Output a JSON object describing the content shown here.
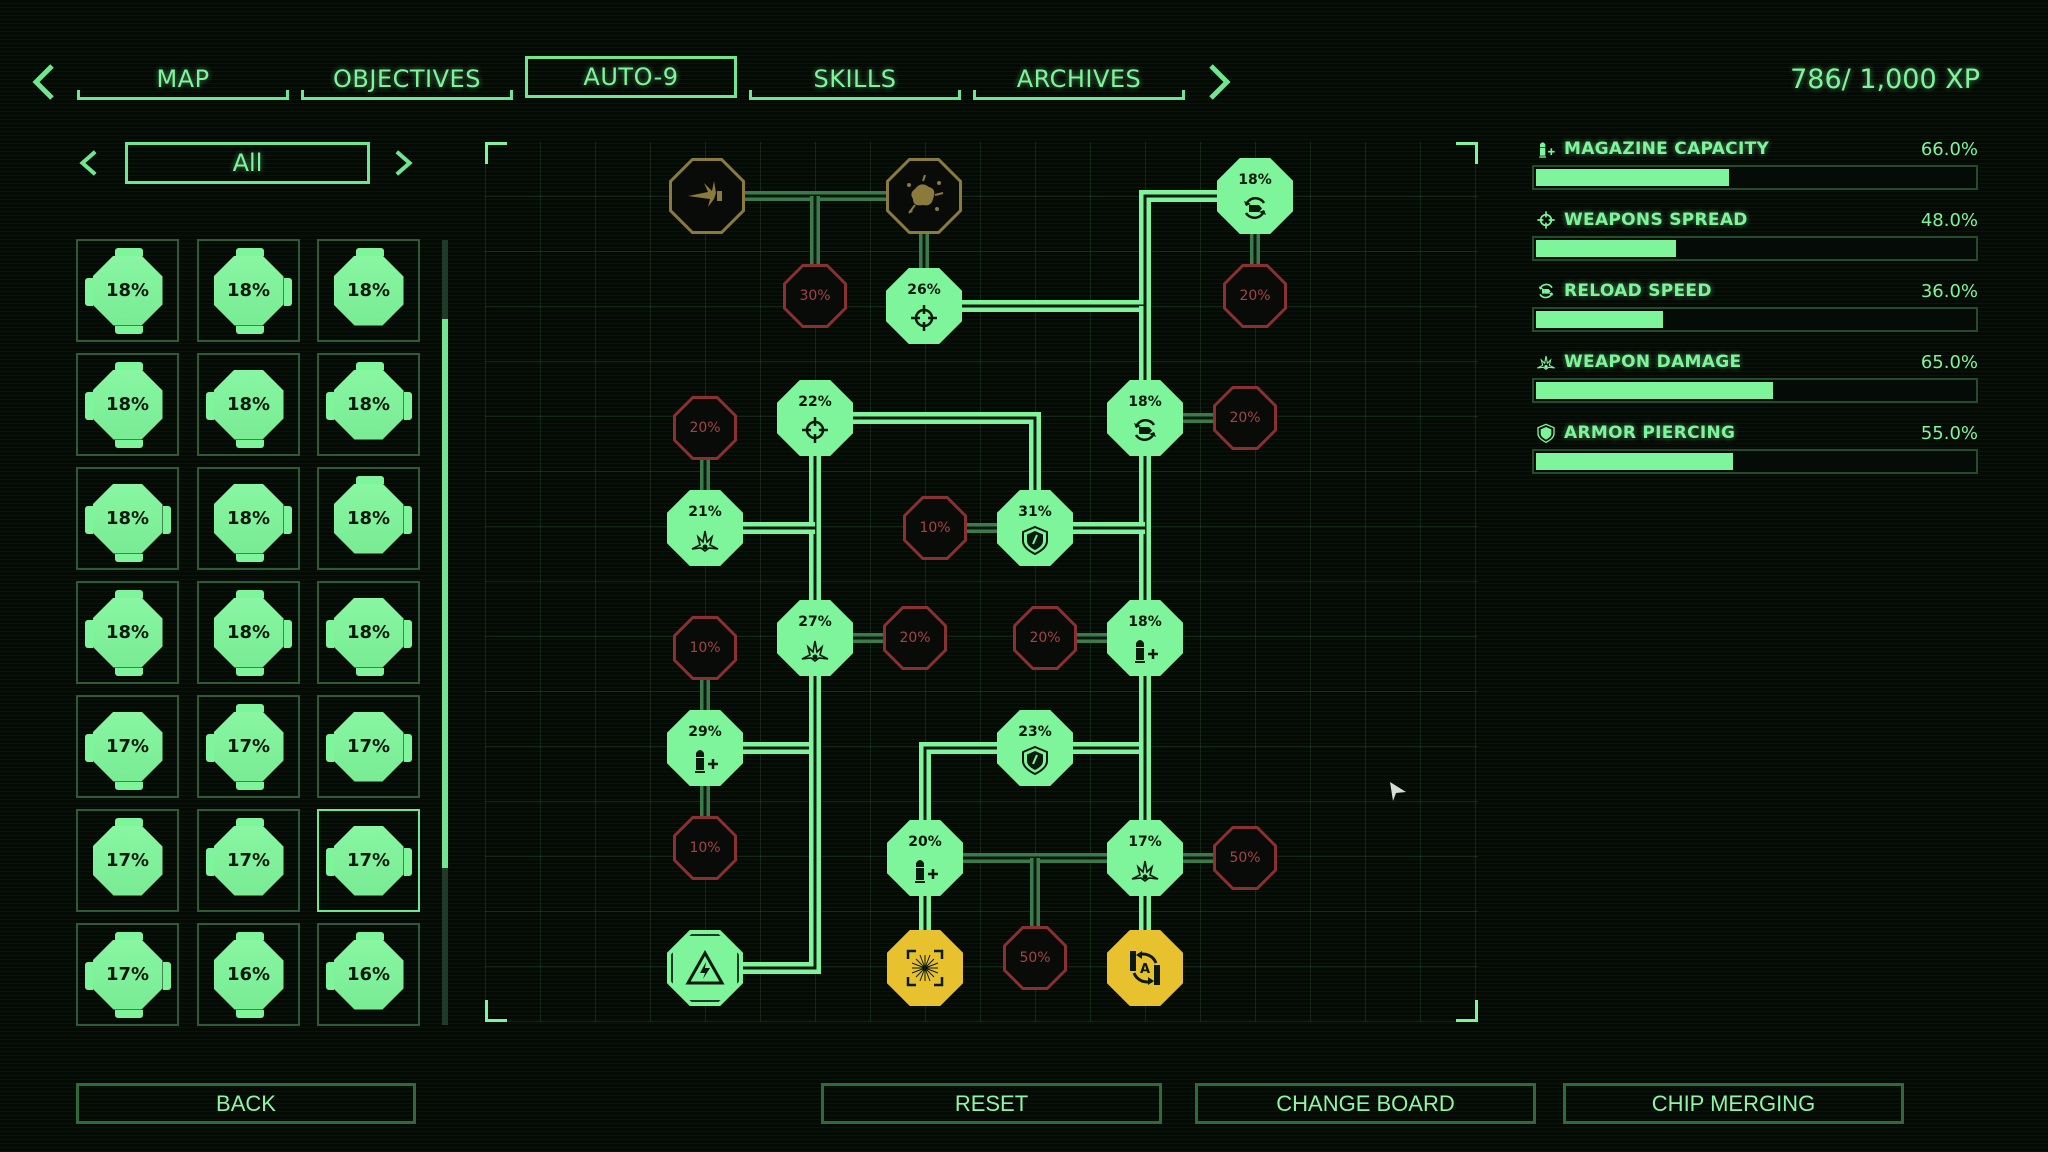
{
  "nav": {
    "tabs": [
      {
        "label": "MAP",
        "active": false
      },
      {
        "label": "OBJECTIVES",
        "active": false
      },
      {
        "label": "AUTO-9",
        "active": true
      },
      {
        "label": "SKILLS",
        "active": false
      },
      {
        "label": "ARCHIVES",
        "active": false
      }
    ],
    "prev_icon": "chevron-left-icon",
    "next_icon": "chevron-right-icon"
  },
  "xp": "786/ 1,000 XP",
  "filter": {
    "selected": "All"
  },
  "chips": [
    {
      "value": "18%"
    },
    {
      "value": "18%"
    },
    {
      "value": "18%"
    },
    {
      "value": "18%"
    },
    {
      "value": "18%"
    },
    {
      "value": "18%"
    },
    {
      "value": "18%"
    },
    {
      "value": "18%"
    },
    {
      "value": "18%"
    },
    {
      "value": "18%"
    },
    {
      "value": "18%"
    },
    {
      "value": "18%"
    },
    {
      "value": "17%"
    },
    {
      "value": "17%"
    },
    {
      "value": "17%"
    },
    {
      "value": "17%"
    },
    {
      "value": "17%"
    },
    {
      "value": "17%",
      "selected": true
    },
    {
      "value": "17%"
    },
    {
      "value": "16%"
    },
    {
      "value": "16%"
    }
  ],
  "chip_list_scroll": {
    "thumb_start_fraction": 0.1,
    "thumb_size_fraction": 0.7
  },
  "board": {
    "nodes": [
      {
        "kind": "locked-gold",
        "icon": "muzzle-flash-icon",
        "value": ""
      },
      {
        "kind": "locked-gold",
        "icon": "splatter-icon",
        "value": ""
      },
      {
        "kind": "empty-red",
        "icon": "",
        "value": "30%"
      },
      {
        "kind": "green",
        "icon": "crosshair-icon",
        "value": "26%"
      },
      {
        "kind": "green",
        "icon": "reload-icon",
        "value": "18%"
      },
      {
        "kind": "empty-red",
        "icon": "",
        "value": "20%"
      },
      {
        "kind": "empty-red",
        "icon": "",
        "value": "20%"
      },
      {
        "kind": "green",
        "icon": "crosshair-icon",
        "value": "22%"
      },
      {
        "kind": "green",
        "icon": "reload-icon",
        "value": "18%"
      },
      {
        "kind": "empty-red",
        "icon": "",
        "value": "20%"
      },
      {
        "kind": "green",
        "icon": "explosion-icon",
        "value": "21%"
      },
      {
        "kind": "empty-red",
        "icon": "",
        "value": "10%"
      },
      {
        "kind": "green",
        "icon": "shield-icon",
        "value": "31%"
      },
      {
        "kind": "empty-red",
        "icon": "",
        "value": "10%"
      },
      {
        "kind": "green",
        "icon": "explosion-icon",
        "value": "27%"
      },
      {
        "kind": "empty-red",
        "icon": "",
        "value": "20%"
      },
      {
        "kind": "empty-red",
        "icon": "",
        "value": "20%"
      },
      {
        "kind": "green",
        "icon": "magazine-icon",
        "value": "18%"
      },
      {
        "kind": "green",
        "icon": "magazine-icon",
        "value": "29%"
      },
      {
        "kind": "green",
        "icon": "shield-icon",
        "value": "23%"
      },
      {
        "kind": "empty-red",
        "icon": "",
        "value": "10%"
      },
      {
        "kind": "green",
        "icon": "magazine-icon",
        "value": "20%"
      },
      {
        "kind": "green",
        "icon": "explosion-icon",
        "value": "17%"
      },
      {
        "kind": "empty-red",
        "icon": "",
        "value": "50%"
      },
      {
        "kind": "core",
        "icon": "power-triangle-icon",
        "value": ""
      },
      {
        "kind": "special-yellow",
        "icon": "laser-sight-icon",
        "value": ""
      },
      {
        "kind": "empty-red",
        "icon": "",
        "value": "50%"
      },
      {
        "kind": "special-yellow",
        "icon": "auto-reload-icon",
        "value": ""
      }
    ]
  },
  "stats": [
    {
      "name": "MAGAZINE CAPACITY",
      "value": "66.0%",
      "icon": "magazine-icon",
      "fill_fraction": 0.44
    },
    {
      "name": "WEAPONS SPREAD",
      "value": "48.0%",
      "icon": "crosshair-icon",
      "fill_fraction": 0.32
    },
    {
      "name": "RELOAD SPEED",
      "value": "36.0%",
      "icon": "reload-icon",
      "fill_fraction": 0.29
    },
    {
      "name": "WEAPON DAMAGE",
      "value": "65.0%",
      "icon": "explosion-icon",
      "fill_fraction": 0.54
    },
    {
      "name": "ARMOR PIERCING",
      "value": "55.0%",
      "icon": "shield-icon",
      "fill_fraction": 0.45
    }
  ],
  "buttons": {
    "back": "BACK",
    "reset": "RESET",
    "change_board": "CHANGE BOARD",
    "chip_merging": "CHIP MERGING"
  },
  "colors": {
    "accent": "#7ef59a",
    "empty_slot": "#a34444",
    "special": "#e8c22e",
    "locked": "#8a7a3c",
    "background": "#040a04"
  }
}
